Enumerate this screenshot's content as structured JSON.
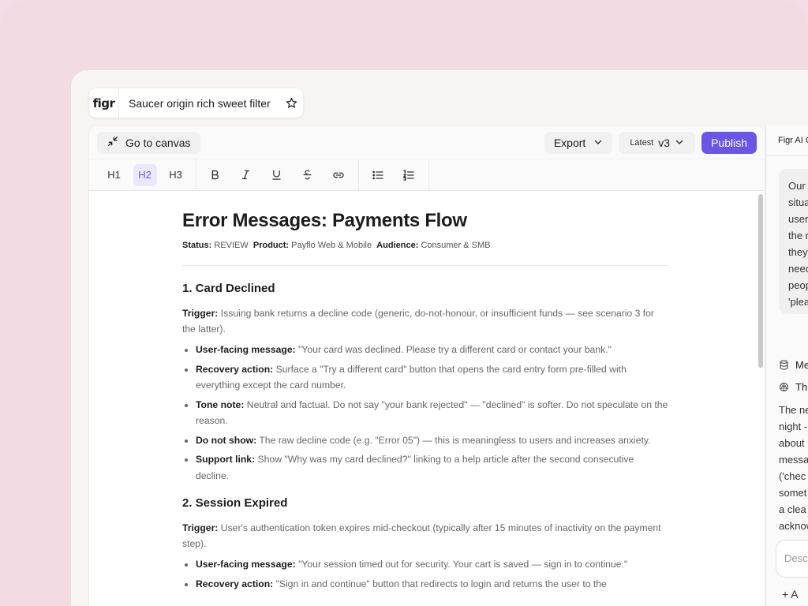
{
  "app": {
    "logo": "figr",
    "doc_title": "Saucer origin rich sweet filter"
  },
  "topbar": {
    "go_to_canvas": "Go to canvas",
    "export": "Export",
    "version_tag": "Latest",
    "version": "v3",
    "publish": "Publish"
  },
  "toolbar": {
    "h1": "H1",
    "h2": "H2",
    "h3": "H3",
    "active": "H2"
  },
  "document": {
    "title": "Error Messages: Payments Flow",
    "meta": {
      "status_label": "Status:",
      "status": "REVIEW",
      "product_label": "Product:",
      "product": "Payflo Web & Mobile",
      "audience_label": "Audience:",
      "audience": "Consumer & SMB"
    },
    "sections": [
      {
        "heading": "1. Card Declined",
        "trigger_label": "Trigger:",
        "trigger": "Issuing bank returns a decline code (generic, do-not-honour, or insufficient funds — see scenario 3 for the latter).",
        "items": [
          {
            "label": "User-facing message:",
            "text": "\"Your card was declined. Please try a different card or contact your bank.\""
          },
          {
            "label": "Recovery action:",
            "text": "Surface a \"Try a different card\" button that opens the card entry form pre-filled with everything except the card number."
          },
          {
            "label": "Tone note:",
            "text": "Neutral and factual. Do not say \"your bank rejected\" — \"declined\" is softer. Do not speculate on the reason."
          },
          {
            "label": "Do not show:",
            "text": "The raw decline code (e.g. \"Error 05\") — this is meaningless to users and increases anxiety."
          },
          {
            "label": "Support link:",
            "text": "Show \"Why was my card declined?\" linking to a help article after the second consecutive decline."
          }
        ]
      },
      {
        "heading": "2. Session Expired",
        "trigger_label": "Trigger:",
        "trigger": "User's authentication token expires mid-checkout (typically after 15 minutes of inactivity on the payment step).",
        "items": [
          {
            "label": "User-facing message:",
            "text": "\"Your session timed out for security. Your cart is saved — sign in to continue.\""
          },
          {
            "label": "Recovery action:",
            "text": "\"Sign in and continue\" button that redirects to login and returns the user to the"
          }
        ]
      }
    ]
  },
  "ai_panel": {
    "title": "Figr AI C",
    "bubble_lines": [
      "Our",
      "situa",
      "user",
      "the r",
      "they",
      "need",
      "peop",
      "'plea"
    ],
    "row1": "Me",
    "row2": "Th",
    "text_lines": [
      "The ne",
      "night -",
      "about",
      "messa",
      "('chec",
      "somet",
      "a clea",
      "acknow"
    ],
    "input_placeholder": "Desc",
    "add_label": "+ A"
  },
  "colors": {
    "accent": "#6a55e6",
    "background": "#f3dbe4"
  }
}
